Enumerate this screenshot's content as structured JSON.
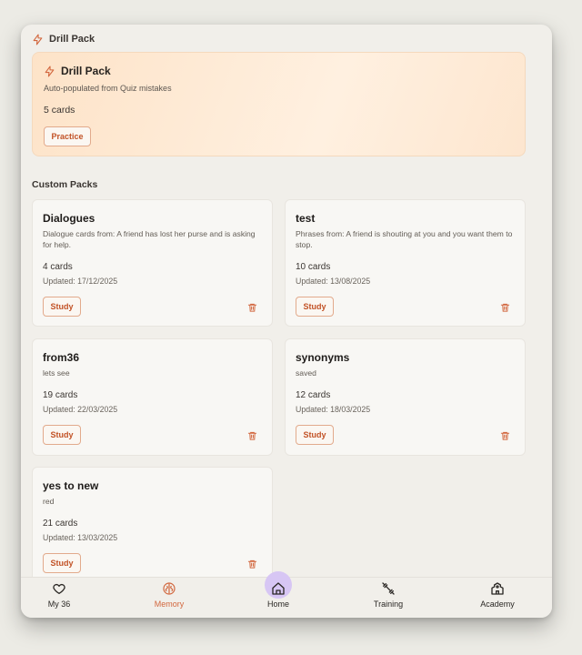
{
  "header": {
    "title": "Drill Pack"
  },
  "drill_pack": {
    "title": "Drill Pack",
    "description": "Auto-populated from Quiz mistakes",
    "count": "5 cards",
    "button": "Practice"
  },
  "custom_packs": {
    "heading": "Custom Packs",
    "study_label": "Study",
    "packs": [
      {
        "name": "Dialogues",
        "description": "Dialogue cards from: A friend has lost her purse and is asking for help.",
        "count": "4 cards",
        "updated": "Updated: 17/12/2025"
      },
      {
        "name": "test",
        "description": "Phrases from: A friend is shouting at you and you want them to stop.",
        "count": "10 cards",
        "updated": "Updated: 13/08/2025"
      },
      {
        "name": "from36",
        "description": "lets see",
        "count": "19 cards",
        "updated": "Updated: 22/03/2025"
      },
      {
        "name": "synonyms",
        "description": "saved",
        "count": "12 cards",
        "updated": "Updated: 18/03/2025"
      },
      {
        "name": "yes to new",
        "description": "red",
        "count": "21 cards",
        "updated": "Updated: 13/03/2025"
      }
    ]
  },
  "nav": {
    "items": [
      {
        "label": "My 36",
        "icon": "heart-icon"
      },
      {
        "label": "Memory",
        "icon": "brain-icon",
        "active": true
      },
      {
        "label": "Home",
        "icon": "home-icon",
        "highlight": true
      },
      {
        "label": "Training",
        "icon": "dumbbell-icon"
      },
      {
        "label": "Academy",
        "icon": "school-icon"
      }
    ]
  },
  "colors": {
    "accent": "#d2673e",
    "drill_bg": "#fde3c8",
    "home_bubble": "#d7c6f4"
  }
}
